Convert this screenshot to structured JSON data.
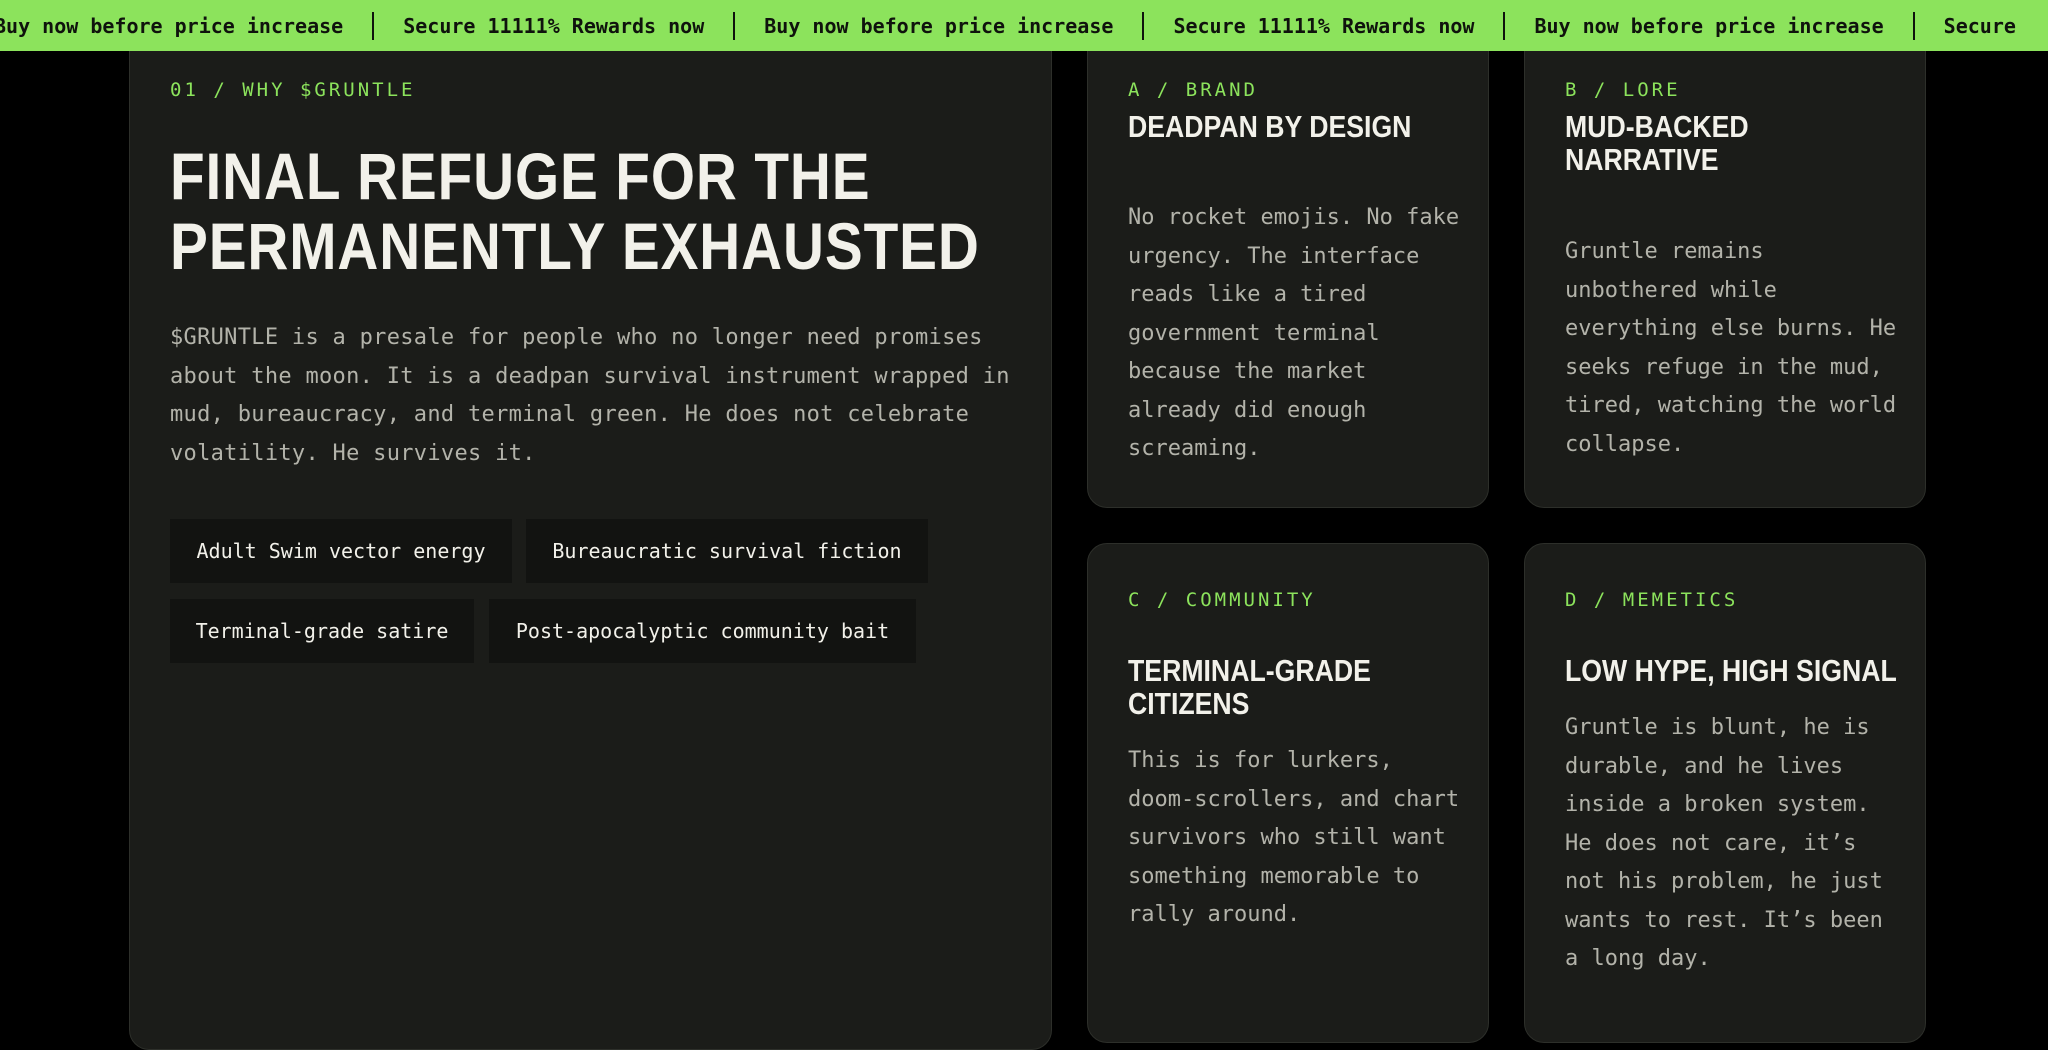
{
  "ticker": {
    "items": [
      "Buy now before price increase",
      "Secure 11111% Rewards now",
      "Buy now before price increase",
      "Secure 11111% Rewards now",
      "Buy now before price increase",
      "Secure"
    ]
  },
  "why": {
    "eyebrow": "01 / WHY $GRUNTLE",
    "title_line1": "FINAL REFUGE FOR THE",
    "title_line2": "PERMANENTLY EXHAUSTED",
    "body": "$GRUNTLE is a presale for people who no longer need promises about the moon. It is a deadpan survival instrument wrapped in mud, bureaucracy, and terminal green. He does not celebrate volatility. He survives it.",
    "tags": [
      "Adult Swim vector energy",
      "Bureaucratic survival fiction",
      "Terminal-grade satire",
      "Post-apocalyptic community bait"
    ]
  },
  "cards": [
    {
      "eyebrow": "A / BRAND",
      "title_line1": "DEADPAN BY DESIGN",
      "title_line2": "",
      "body": "No rocket emojis. No fake urgency. The interface reads like a tired government terminal because the market already did enough screaming."
    },
    {
      "eyebrow": "B / LORE",
      "title_line1": "MUD-BACKED",
      "title_line2": "NARRATIVE",
      "body": "Gruntle remains unbothered while everything else burns. He seeks refuge in the mud, tired, watching the world collapse."
    },
    {
      "eyebrow": "C / COMMUNITY",
      "title_line1": "TERMINAL-GRADE",
      "title_line2": "CITIZENS",
      "body": "This is for lurkers, doom-scrollers, and chart survivors who still want something memorable to rally around."
    },
    {
      "eyebrow": "D / MEMETICS",
      "title_line1": "LOW HYPE, HIGH SIGNAL",
      "title_line2": "",
      "body": "Gruntle is blunt, he is durable, and he lives inside a broken system. He does not care, it’s not his problem, he just wants to rest. It’s been a long day."
    }
  ],
  "colors": {
    "accent": "#8ce35c",
    "background": "#000000",
    "card": "#1b1c19",
    "title": "#f2f1ea",
    "body": "#b3b3aa"
  }
}
